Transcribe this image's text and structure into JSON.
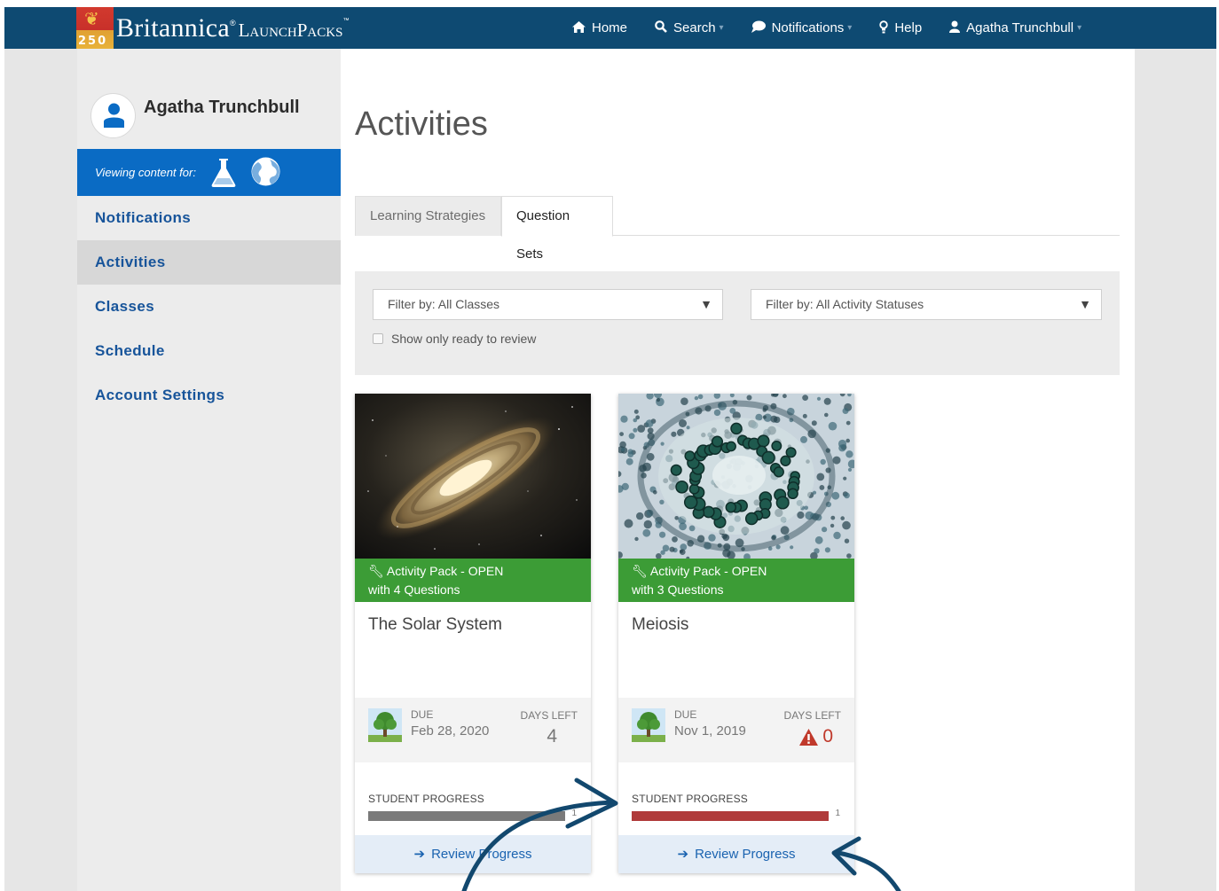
{
  "header": {
    "logo_badge_text": "250",
    "logo_brand": "Britannica",
    "logo_product": "LaunchPacks",
    "nav": [
      {
        "label": "Home",
        "icon": "home-icon",
        "dropdown": false
      },
      {
        "label": "Search",
        "icon": "search-icon",
        "dropdown": true
      },
      {
        "label": "Notifications",
        "icon": "chat-bubble-icon",
        "dropdown": true
      },
      {
        "label": "Help",
        "icon": "lightbulb-icon",
        "dropdown": false
      },
      {
        "label": "Agatha Trunchbull",
        "icon": "user-icon",
        "dropdown": true
      }
    ]
  },
  "sidebar": {
    "user_name": "Agatha Trunchbull",
    "viewing_label": "Viewing content for:",
    "items": [
      {
        "label": "Notifications",
        "active": false
      },
      {
        "label": "Activities",
        "active": true
      },
      {
        "label": "Classes",
        "active": false
      },
      {
        "label": "Schedule",
        "active": false
      },
      {
        "label": "Account Settings",
        "active": false
      }
    ]
  },
  "main": {
    "title": "Activities",
    "tabs": [
      {
        "label": "Learning Strategies",
        "active": false
      },
      {
        "label": "Question Sets",
        "active": true
      }
    ],
    "filters": {
      "class_filter": "Filter by: All Classes",
      "status_filter": "Filter by: All Activity Statuses",
      "review_checkbox_label": "Show only ready to review",
      "review_checked": false
    },
    "cards": [
      {
        "banner_line1": "Activity Pack - OPEN",
        "banner_line2": "with 4 Questions",
        "title": "The Solar System",
        "due_label": "DUE",
        "due_date": "Feb 28, 2020",
        "days_left_label": "DAYS LEFT",
        "days_left": "4",
        "overdue": false,
        "progress_label": "STUDENT PROGRESS",
        "progress_count": "1",
        "progress_fraction": 1.0,
        "progress_color": "#7a7a7a",
        "action_label": "Review Progress"
      },
      {
        "banner_line1": "Activity Pack - OPEN",
        "banner_line2": "with 3 Questions",
        "title": "Meiosis",
        "due_label": "DUE",
        "due_date": "Nov 1, 2019",
        "days_left_label": "DAYS LEFT",
        "days_left": "0",
        "overdue": true,
        "progress_label": "STUDENT PROGRESS",
        "progress_count": "1",
        "progress_fraction": 1.0,
        "progress_color": "#b03a3a",
        "action_label": "Review Progress"
      }
    ]
  },
  "colors": {
    "nav_bg": "#0e4a72",
    "viewing_bar": "#0a6bc4",
    "sidebar_link": "#17549a",
    "banner_green": "#3c9c36",
    "alert_red": "#c0392b",
    "annotation_arrow": "#12486e"
  }
}
